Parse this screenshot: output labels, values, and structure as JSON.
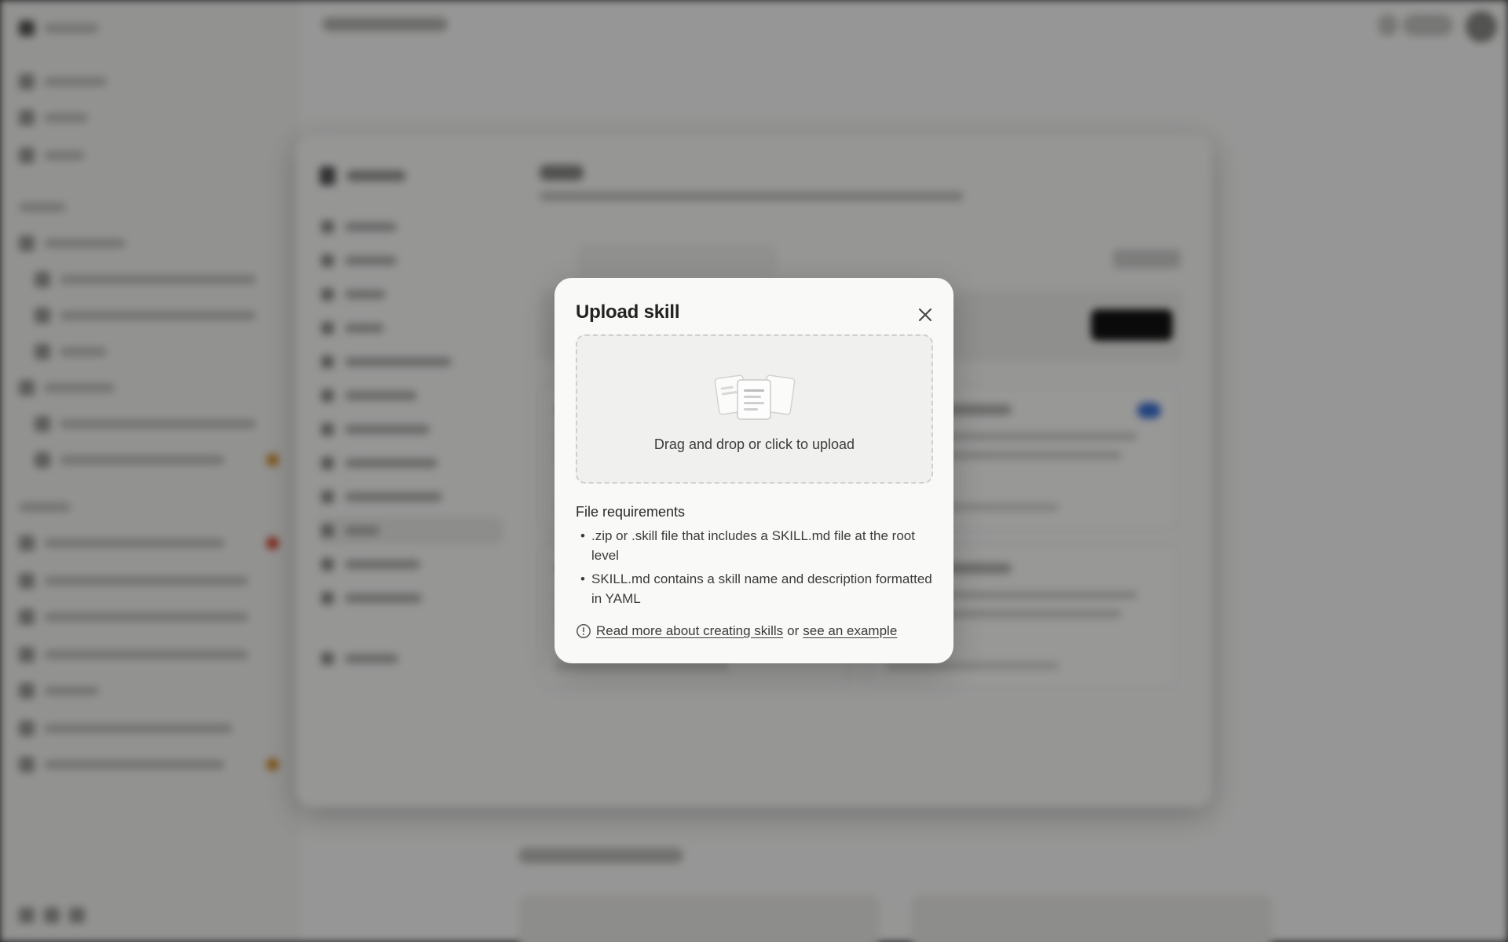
{
  "dialog": {
    "title": "Upload skill",
    "dropzone_text": "Drag and drop or click to upload",
    "requirements_title": "File requirements",
    "requirements": [
      ".zip or .skill file that includes a SKILL.md file at the root level",
      "SKILL.md contains a skill name and description formatted in YAML"
    ],
    "help_link_text": "Read more about creating skills",
    "help_separator": "or",
    "example_link_text": "see an example",
    "icons": {
      "close": "close-icon",
      "info": "info-icon",
      "upload_art": "documents-illustration"
    }
  },
  "colors": {
    "overlay": "#00000066",
    "dialog_bg": "#f9f9f8",
    "accent_toggle": "#3b6fd4"
  }
}
